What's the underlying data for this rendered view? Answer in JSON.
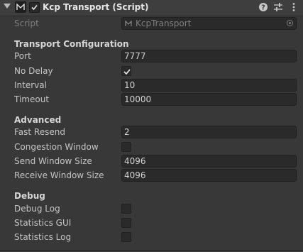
{
  "header": {
    "title": "Kcp Transport (Script)",
    "enabled": true,
    "icons": [
      "foldout-arrow-icon",
      "script-component-icon",
      "help-icon",
      "preset-icon",
      "context-menu-icon"
    ]
  },
  "script_field": {
    "label": "Script",
    "value": "KcpTransport"
  },
  "sections": {
    "transport": {
      "title": "Transport Configuration",
      "port": {
        "label": "Port",
        "value": "7777"
      },
      "nodelay": {
        "label": "No Delay",
        "checked": true
      },
      "interval": {
        "label": "Interval",
        "value": "10"
      },
      "timeout": {
        "label": "Timeout",
        "value": "10000"
      }
    },
    "advanced": {
      "title": "Advanced",
      "fastresend": {
        "label": "Fast Resend",
        "value": "2"
      },
      "congestion": {
        "label": "Congestion Window",
        "checked": false
      },
      "sendwindow": {
        "label": "Send Window Size",
        "value": "4096"
      },
      "receivewindow": {
        "label": "Receive Window Size",
        "value": "4096"
      }
    },
    "debug": {
      "title": "Debug",
      "debuglog": {
        "label": "Debug Log",
        "checked": false
      },
      "statsgui": {
        "label": "Statistics GUI",
        "checked": false
      },
      "statslog": {
        "label": "Statistics Log",
        "checked": false
      }
    }
  },
  "colors": {
    "background": "#383838",
    "header": "#3e3e3e",
    "field": "#2a2a2a",
    "text": "#c4c4c4"
  }
}
